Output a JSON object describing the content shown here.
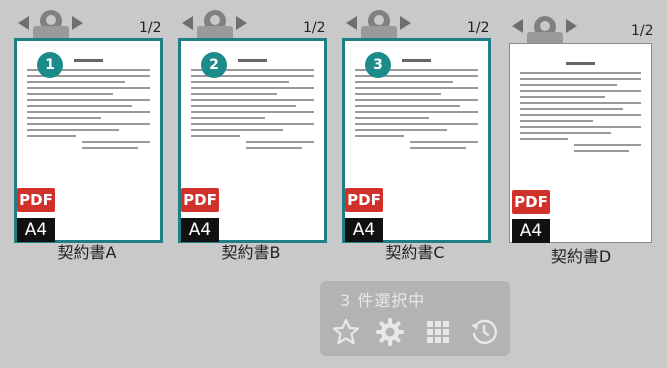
{
  "documents": [
    {
      "name": "契約書A",
      "page": "1/2",
      "badge": "1",
      "format": "PDF",
      "size": "A4",
      "selected": true
    },
    {
      "name": "契約書B",
      "page": "1/2",
      "badge": "2",
      "format": "PDF",
      "size": "A4",
      "selected": true
    },
    {
      "name": "契約書C",
      "page": "1/2",
      "badge": "3",
      "format": "PDF",
      "size": "A4",
      "selected": true
    },
    {
      "name": "契約書D",
      "page": "1/2",
      "badge": "",
      "format": "PDF",
      "size": "A4",
      "selected": false
    }
  ],
  "selection_panel": {
    "text": "3 件選択中",
    "icons": [
      "star-icon",
      "gear-icon",
      "grid-icon",
      "history-icon"
    ]
  },
  "colors": {
    "selection_border": "#1f7f87",
    "badge": "#1b8c8a",
    "pdf_badge": "#d0312b",
    "background": "#c9c9c9"
  }
}
